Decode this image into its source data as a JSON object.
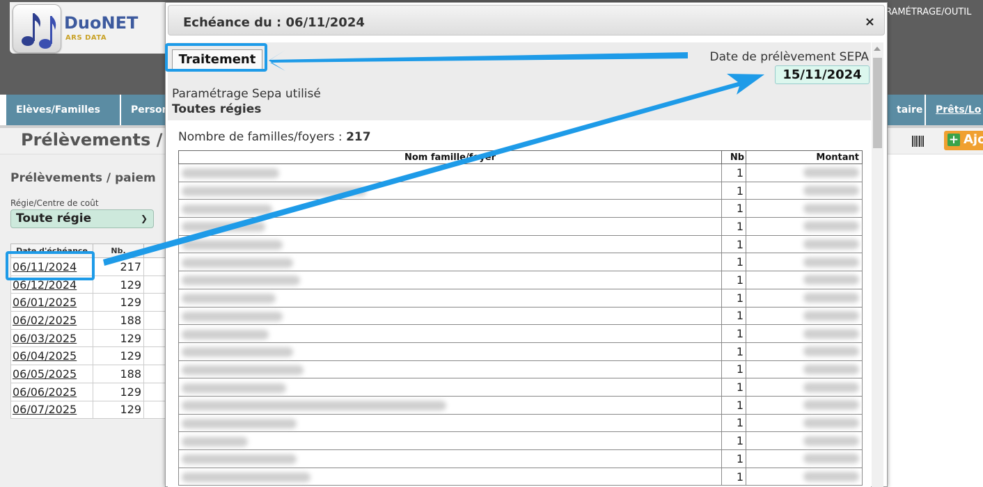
{
  "app": {
    "name": "DuoNET",
    "subtitle": "ARS DATA",
    "top_menu_fragment": "RAMÉTRAGE/OUTIL"
  },
  "nav": {
    "tabs": [
      {
        "label": "Elèves/Familles"
      },
      {
        "label": "Person"
      },
      {
        "label": "taire"
      },
      {
        "label": "Prêts/Lo"
      }
    ]
  },
  "page": {
    "title": "Prélèvements /",
    "add_label": "Ajo"
  },
  "left": {
    "section_title": "Prélèvements / paiem",
    "regie_label": "Régie/Centre de coût",
    "regie_value": "Toute régie",
    "table": {
      "headers": [
        "Date d'échéance",
        "Nb."
      ],
      "rows": [
        {
          "date": "06/11/2024",
          "nb": "217"
        },
        {
          "date": "06/12/2024",
          "nb": "129"
        },
        {
          "date": "06/01/2025",
          "nb": "129"
        },
        {
          "date": "06/02/2025",
          "nb": "188"
        },
        {
          "date": "06/03/2025",
          "nb": "129"
        },
        {
          "date": "06/04/2025",
          "nb": "129"
        },
        {
          "date": "06/05/2025",
          "nb": "188"
        },
        {
          "date": "06/06/2025",
          "nb": "129"
        },
        {
          "date": "06/07/2025",
          "nb": "129"
        }
      ]
    }
  },
  "modal": {
    "title": "Echéance du : 06/11/2024",
    "close": "×",
    "traitement": "Traitement",
    "sepa_label": "Date de prélèvement SEPA",
    "sepa_date": "15/11/2024",
    "param_label": "Paramétrage Sepa utilisé",
    "param_value": "Toutes régies",
    "families_label": "Nombre de familles/foyers :",
    "families_count": "217",
    "table": {
      "headers": {
        "name": "Nom famille/foyer",
        "nb": "Nb",
        "amount": "Montant"
      },
      "rows": [
        {
          "nb": "1"
        },
        {
          "nb": "1"
        },
        {
          "nb": "1"
        },
        {
          "nb": "1"
        },
        {
          "nb": "1"
        },
        {
          "nb": "1"
        },
        {
          "nb": "1"
        },
        {
          "nb": "1"
        },
        {
          "nb": "1"
        },
        {
          "nb": "1"
        },
        {
          "nb": "1"
        },
        {
          "nb": "1"
        },
        {
          "nb": "1"
        },
        {
          "nb": "1"
        },
        {
          "nb": "1"
        },
        {
          "nb": "1"
        },
        {
          "nb": "1"
        },
        {
          "nb": "1"
        }
      ]
    }
  },
  "colors": {
    "highlight": "#1e9be8",
    "nav_tab": "#5b8ca3",
    "topbar": "#5e5e5e",
    "select_bg": "#cde9dc",
    "sepa_date_bg": "#dcf7ee"
  }
}
